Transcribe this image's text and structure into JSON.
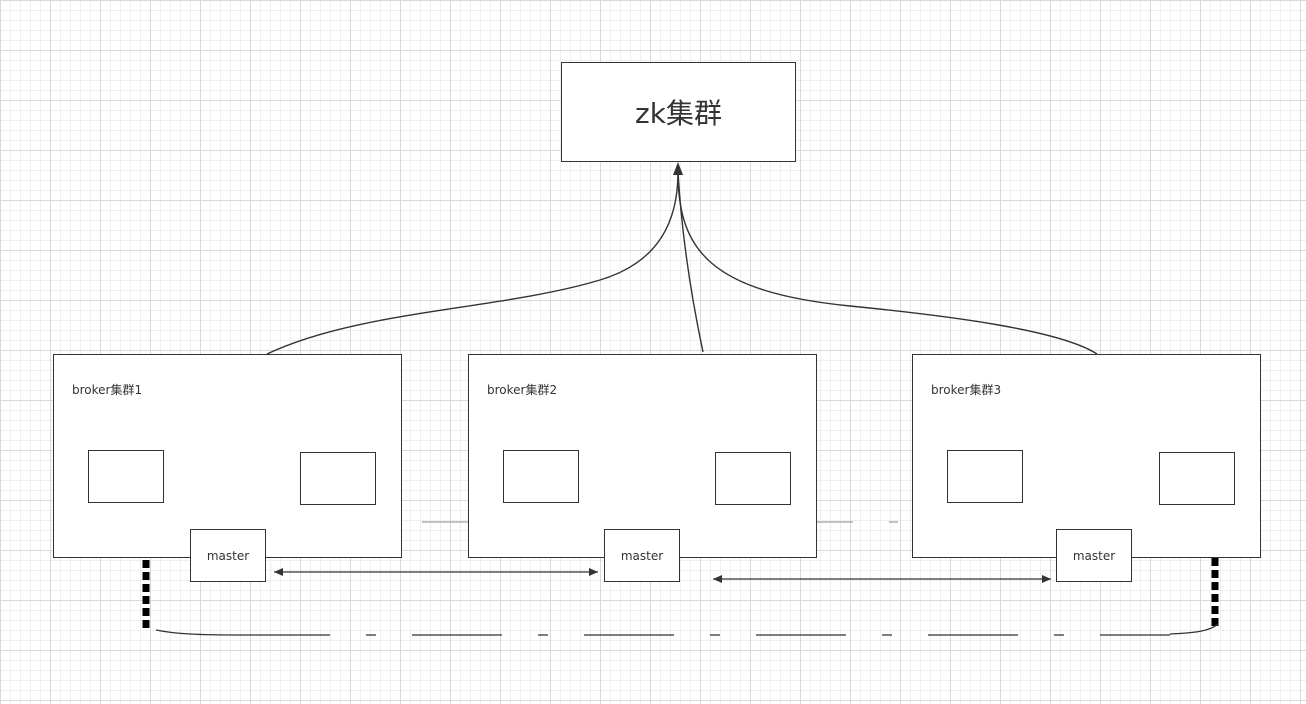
{
  "zk": {
    "label": "zk集群"
  },
  "brokers": [
    {
      "label": "broker集群1",
      "master": "master"
    },
    {
      "label": "broker集群2",
      "master": "master"
    },
    {
      "label": "broker集群3",
      "master": "master"
    }
  ]
}
